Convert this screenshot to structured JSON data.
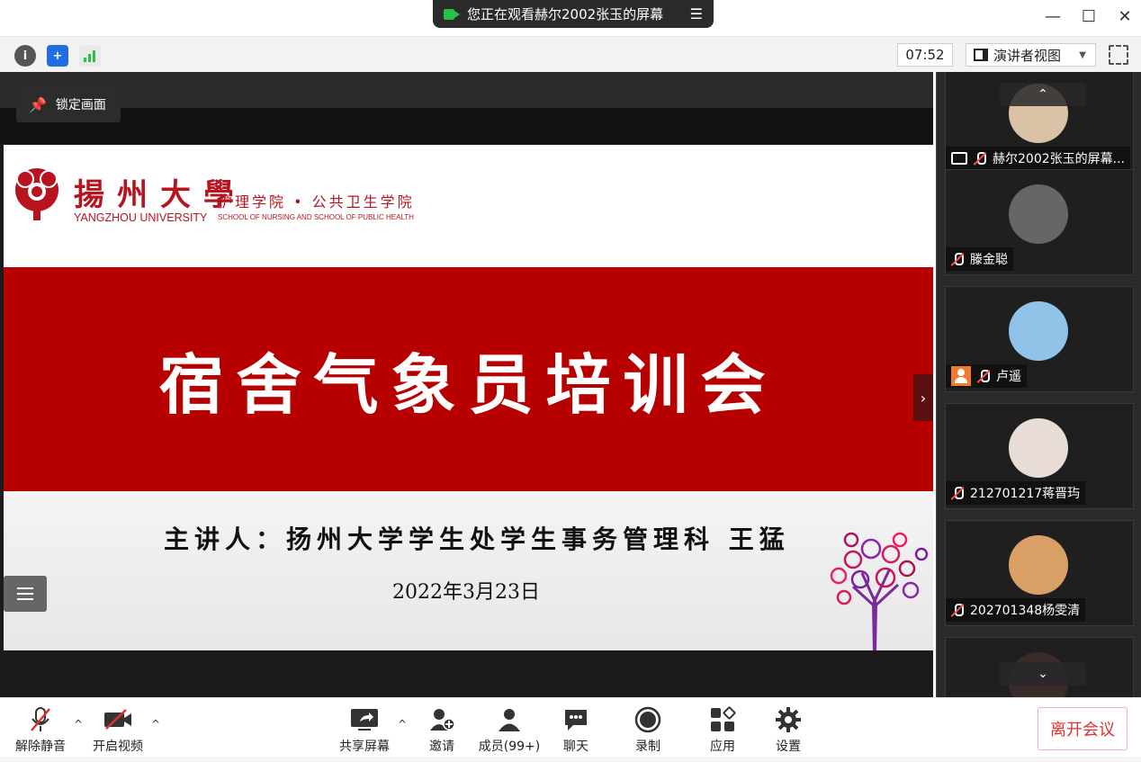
{
  "window": {
    "share_banner": "您正在观看赫尔2002张玉的屏幕",
    "minimize": "—",
    "maximize": "☐",
    "close": "✕"
  },
  "toolbar": {
    "timer": "07:52",
    "view_mode": "演讲者视图"
  },
  "stage": {
    "lock_label": "锁定画面"
  },
  "slide": {
    "university_cn": "揚州大學",
    "university_en": "YANGZHOU UNIVERSITY",
    "school_cn": "护理学院 • 公共卫生学院",
    "school_en": "SCHOOL OF NURSING AND SCHOOL OF PUBLIC HEALTH",
    "title": "宿舍气象员培训会",
    "speaker": "主讲人：扬州大学学生处学生事务管理科 王猛",
    "date": "2022年3月23日"
  },
  "participants": [
    {
      "name": "赫尔2002张玉的屏幕...",
      "sharing": true,
      "avatar_color": "#d9c2a6"
    },
    {
      "name": "滕金聪",
      "avatar_color": "#666666"
    },
    {
      "name": "卢遥",
      "host_icon": true,
      "avatar_color": "#8fc4e8"
    },
    {
      "name": "212701217蒋晋玙",
      "avatar_color": "#e8dcd6"
    },
    {
      "name": "202701348杨雯清",
      "avatar_color": "#d9a066"
    }
  ],
  "controls": {
    "unmute": "解除静音",
    "start_video": "开启视频",
    "share_screen": "共享屏幕",
    "invite": "邀请",
    "members": "成员(99+)",
    "chat": "聊天",
    "record": "录制",
    "apps": "应用",
    "settings": "设置",
    "leave": "离开会议"
  },
  "colors": {
    "accent_red": "#b70000",
    "leave_red": "#e03030",
    "signal_green": "#27c24c",
    "shield_blue": "#1f6fde"
  }
}
